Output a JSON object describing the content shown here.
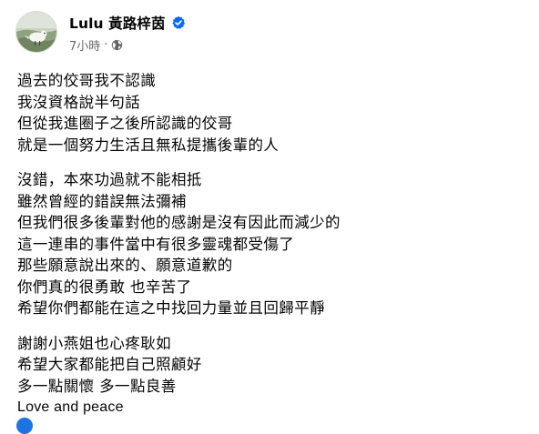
{
  "post": {
    "author": "Lulu 黃路梓茵",
    "time": "7小時",
    "separator": "·",
    "audience_icon": "globe-icon",
    "verified_icon": "verified-badge-icon",
    "colors": {
      "text": "#050505",
      "meta": "#65676b",
      "verified": "#0866ff",
      "reaction": "#1b74e4"
    },
    "paragraphs": [
      {
        "lines": [
          "過去的佼哥我不認識",
          "我沒資格說半句話",
          "但從我進圈子之後所認識的佼哥",
          "就是一個努力生活且無私提攜後輩的人"
        ]
      },
      {
        "lines": [
          "沒錯，本來功過就不能相抵",
          "雖然曾經的錯誤無法彌補",
          "但我們很多後輩對他的感謝是沒有因此而減少的",
          "這一連串的事件當中有很多靈魂都受傷了",
          "那些願意說出來的、願意道歉的",
          "你們真的很勇敢 也辛苦了",
          "希望你們都能在這之中找回力量並且回歸平靜"
        ]
      },
      {
        "lines": [
          "謝謝小燕姐也心疼耿如",
          "希望大家都能把自己照顧好",
          "多一點關懷 多一點良善",
          "Love and peace"
        ]
      }
    ]
  }
}
